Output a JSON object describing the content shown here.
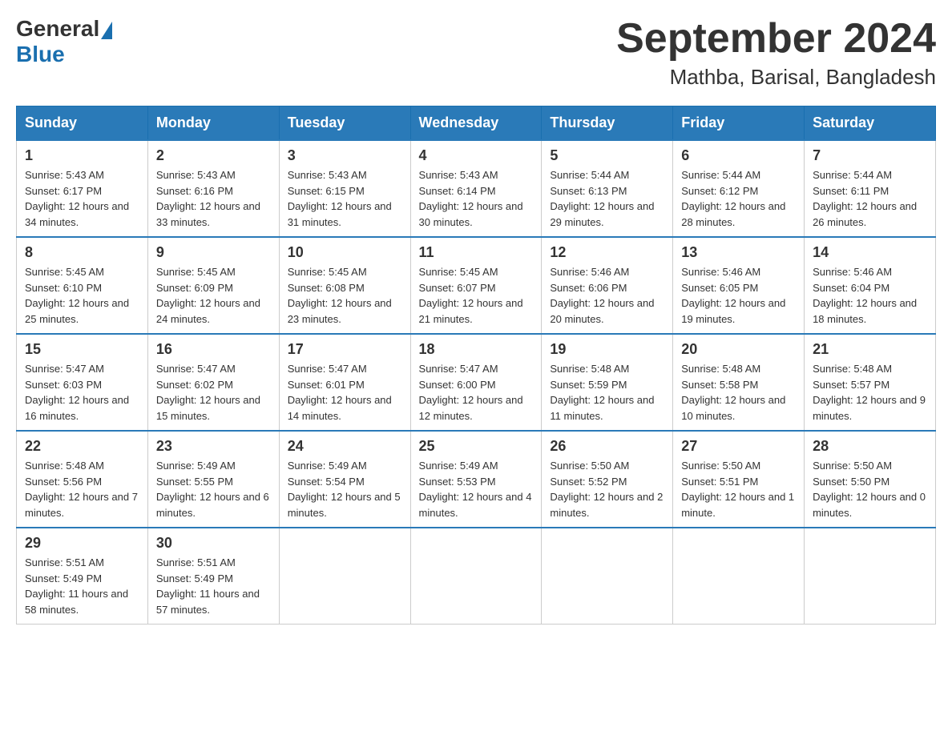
{
  "header": {
    "logo_general": "General",
    "logo_blue": "Blue",
    "month_title": "September 2024",
    "location": "Mathba, Barisal, Bangladesh"
  },
  "weekdays": [
    "Sunday",
    "Monday",
    "Tuesday",
    "Wednesday",
    "Thursday",
    "Friday",
    "Saturday"
  ],
  "weeks": [
    [
      {
        "day": "1",
        "sunrise": "5:43 AM",
        "sunset": "6:17 PM",
        "daylight": "12 hours and 34 minutes."
      },
      {
        "day": "2",
        "sunrise": "5:43 AM",
        "sunset": "6:16 PM",
        "daylight": "12 hours and 33 minutes."
      },
      {
        "day": "3",
        "sunrise": "5:43 AM",
        "sunset": "6:15 PM",
        "daylight": "12 hours and 31 minutes."
      },
      {
        "day": "4",
        "sunrise": "5:43 AM",
        "sunset": "6:14 PM",
        "daylight": "12 hours and 30 minutes."
      },
      {
        "day": "5",
        "sunrise": "5:44 AM",
        "sunset": "6:13 PM",
        "daylight": "12 hours and 29 minutes."
      },
      {
        "day": "6",
        "sunrise": "5:44 AM",
        "sunset": "6:12 PM",
        "daylight": "12 hours and 28 minutes."
      },
      {
        "day": "7",
        "sunrise": "5:44 AM",
        "sunset": "6:11 PM",
        "daylight": "12 hours and 26 minutes."
      }
    ],
    [
      {
        "day": "8",
        "sunrise": "5:45 AM",
        "sunset": "6:10 PM",
        "daylight": "12 hours and 25 minutes."
      },
      {
        "day": "9",
        "sunrise": "5:45 AM",
        "sunset": "6:09 PM",
        "daylight": "12 hours and 24 minutes."
      },
      {
        "day": "10",
        "sunrise": "5:45 AM",
        "sunset": "6:08 PM",
        "daylight": "12 hours and 23 minutes."
      },
      {
        "day": "11",
        "sunrise": "5:45 AM",
        "sunset": "6:07 PM",
        "daylight": "12 hours and 21 minutes."
      },
      {
        "day": "12",
        "sunrise": "5:46 AM",
        "sunset": "6:06 PM",
        "daylight": "12 hours and 20 minutes."
      },
      {
        "day": "13",
        "sunrise": "5:46 AM",
        "sunset": "6:05 PM",
        "daylight": "12 hours and 19 minutes."
      },
      {
        "day": "14",
        "sunrise": "5:46 AM",
        "sunset": "6:04 PM",
        "daylight": "12 hours and 18 minutes."
      }
    ],
    [
      {
        "day": "15",
        "sunrise": "5:47 AM",
        "sunset": "6:03 PM",
        "daylight": "12 hours and 16 minutes."
      },
      {
        "day": "16",
        "sunrise": "5:47 AM",
        "sunset": "6:02 PM",
        "daylight": "12 hours and 15 minutes."
      },
      {
        "day": "17",
        "sunrise": "5:47 AM",
        "sunset": "6:01 PM",
        "daylight": "12 hours and 14 minutes."
      },
      {
        "day": "18",
        "sunrise": "5:47 AM",
        "sunset": "6:00 PM",
        "daylight": "12 hours and 12 minutes."
      },
      {
        "day": "19",
        "sunrise": "5:48 AM",
        "sunset": "5:59 PM",
        "daylight": "12 hours and 11 minutes."
      },
      {
        "day": "20",
        "sunrise": "5:48 AM",
        "sunset": "5:58 PM",
        "daylight": "12 hours and 10 minutes."
      },
      {
        "day": "21",
        "sunrise": "5:48 AM",
        "sunset": "5:57 PM",
        "daylight": "12 hours and 9 minutes."
      }
    ],
    [
      {
        "day": "22",
        "sunrise": "5:48 AM",
        "sunset": "5:56 PM",
        "daylight": "12 hours and 7 minutes."
      },
      {
        "day": "23",
        "sunrise": "5:49 AM",
        "sunset": "5:55 PM",
        "daylight": "12 hours and 6 minutes."
      },
      {
        "day": "24",
        "sunrise": "5:49 AM",
        "sunset": "5:54 PM",
        "daylight": "12 hours and 5 minutes."
      },
      {
        "day": "25",
        "sunrise": "5:49 AM",
        "sunset": "5:53 PM",
        "daylight": "12 hours and 4 minutes."
      },
      {
        "day": "26",
        "sunrise": "5:50 AM",
        "sunset": "5:52 PM",
        "daylight": "12 hours and 2 minutes."
      },
      {
        "day": "27",
        "sunrise": "5:50 AM",
        "sunset": "5:51 PM",
        "daylight": "12 hours and 1 minute."
      },
      {
        "day": "28",
        "sunrise": "5:50 AM",
        "sunset": "5:50 PM",
        "daylight": "12 hours and 0 minutes."
      }
    ],
    [
      {
        "day": "29",
        "sunrise": "5:51 AM",
        "sunset": "5:49 PM",
        "daylight": "11 hours and 58 minutes."
      },
      {
        "day": "30",
        "sunrise": "5:51 AM",
        "sunset": "5:49 PM",
        "daylight": "11 hours and 57 minutes."
      },
      null,
      null,
      null,
      null,
      null
    ]
  ],
  "labels": {
    "sunrise_prefix": "Sunrise: ",
    "sunset_prefix": "Sunset: ",
    "daylight_prefix": "Daylight: "
  }
}
